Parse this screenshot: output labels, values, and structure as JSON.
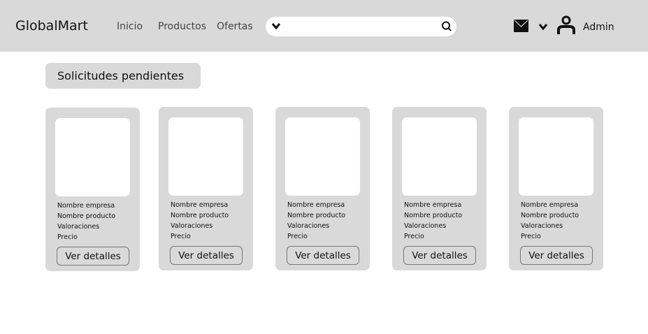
{
  "header": {
    "logo": "GlobalMart",
    "nav": [
      "Inicio",
      "Productos",
      "Ofertas"
    ],
    "search_placeholder": "",
    "user": "Admin"
  },
  "section": {
    "title": "Solicitudes pendientes"
  },
  "cards": [
    {
      "company": "Nombre empresa",
      "product": "Nombre producto",
      "ratings": "Valoraciones",
      "price": "Precio",
      "button": "Ver detalles"
    },
    {
      "company": "Nombre empresa",
      "product": "Nombre producto",
      "ratings": "Valoraciones",
      "price": "Precio",
      "button": "Ver detalles"
    },
    {
      "company": "Nombre empresa",
      "product": "Nombre producto",
      "ratings": "Valoraciones",
      "price": "Precio",
      "button": "Ver detalles"
    },
    {
      "company": "Nombre empresa",
      "product": "Nombre producto",
      "ratings": "Valoraciones",
      "price": "Precio",
      "button": "Ver detalles"
    },
    {
      "company": "Nombre empresa",
      "product": "Nombre producto",
      "ratings": "Valoraciones",
      "price": "Precio",
      "button": "Ver detalles"
    }
  ]
}
